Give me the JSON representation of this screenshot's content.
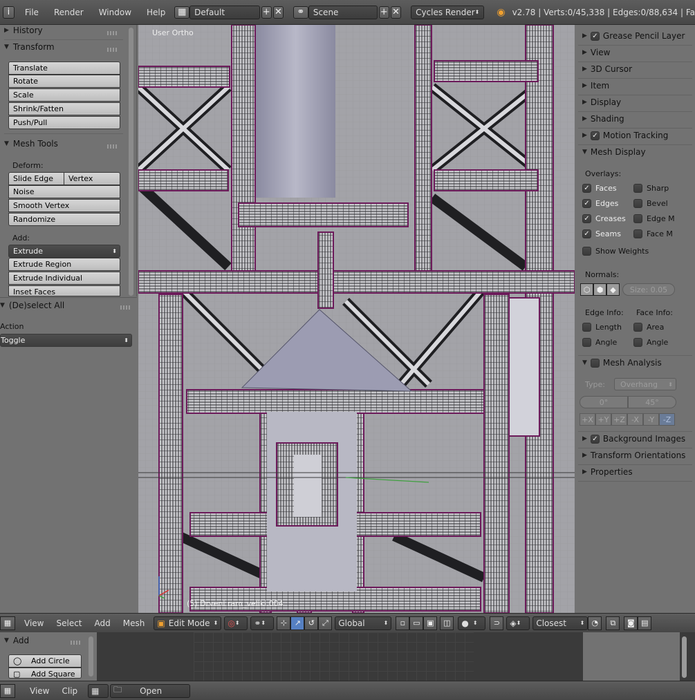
{
  "top_bar": {
    "menus": [
      "File",
      "Render",
      "Window",
      "Help"
    ],
    "layout_value": "Default",
    "scene_value": "Scene",
    "render_engine": "Cycles Render",
    "stats": "v2.78 | Verts:0/45,338 | Edges:0/88,634 | Fa"
  },
  "left_panel": {
    "history": "History",
    "transform": "Transform",
    "transform_buttons": [
      "Translate",
      "Rotate",
      "Scale",
      "Shrink/Fatten",
      "Push/Pull"
    ],
    "mesh_tools": "Mesh Tools",
    "deform_label": "Deform:",
    "slide_edge": "Slide Edge",
    "vertex": "Vertex",
    "deform_buttons": [
      "Noise",
      "Smooth Vertex",
      "Randomize"
    ],
    "add_label": "Add:",
    "extrude_value": "Extrude",
    "add_buttons": [
      "Extrude Region",
      "Extrude Individual",
      "Inset Faces"
    ]
  },
  "operator_panel": {
    "title": "(De)select All",
    "action_label": "Action",
    "action_value": "Toggle"
  },
  "viewport": {
    "view_name": "User Ortho",
    "object_info": "(5) Drveni ram_veliki.004"
  },
  "right_panel": {
    "grease_pencil": "Grease Pencil Layer",
    "view": "View",
    "cursor_3d": "3D Cursor",
    "item": "Item",
    "display": "Display",
    "shading": "Shading",
    "motion_tracking": "Motion Tracking",
    "mesh_display": "Mesh Display",
    "overlays_label": "Overlays:",
    "overlays_left": [
      "Faces",
      "Edges",
      "Creases",
      "Seams"
    ],
    "overlays_right": [
      "Sharp",
      "Bevel",
      "Edge M",
      "Face M"
    ],
    "show_weights": "Show Weights",
    "normals_label": "Normals:",
    "normals_size": "Size: 0.05",
    "edge_info": "Edge Info:",
    "face_info": "Face Info:",
    "length": "Length",
    "area": "Area",
    "angle_edge": "Angle",
    "angle_face": "Angle",
    "mesh_analysis": "Mesh Analysis",
    "type_label": "Type:",
    "type_value": "Overhang",
    "range_min": "0°",
    "range_max": "45°",
    "axes": [
      "+X",
      "+Y",
      "+Z",
      "-X",
      "-Y",
      "-Z"
    ],
    "background_images": "Background Images",
    "transform_orientations": "Transform Orientations",
    "properties": "Properties"
  },
  "viewport_header": {
    "menus": [
      "View",
      "Select",
      "Add",
      "Mesh"
    ],
    "mode": "Edit Mode",
    "orientation": "Global",
    "snap_target": "Closest"
  },
  "bottom_editor": {
    "add_panel": "Add",
    "add_circle": "Add Circle",
    "add_square": "Add Square",
    "menus": [
      "View",
      "Clip"
    ],
    "open_label": "Open"
  },
  "colors": {
    "accent_blue": "#5680c2",
    "edge_purple": "#6c1a5a",
    "panel_gray": "#727272"
  }
}
